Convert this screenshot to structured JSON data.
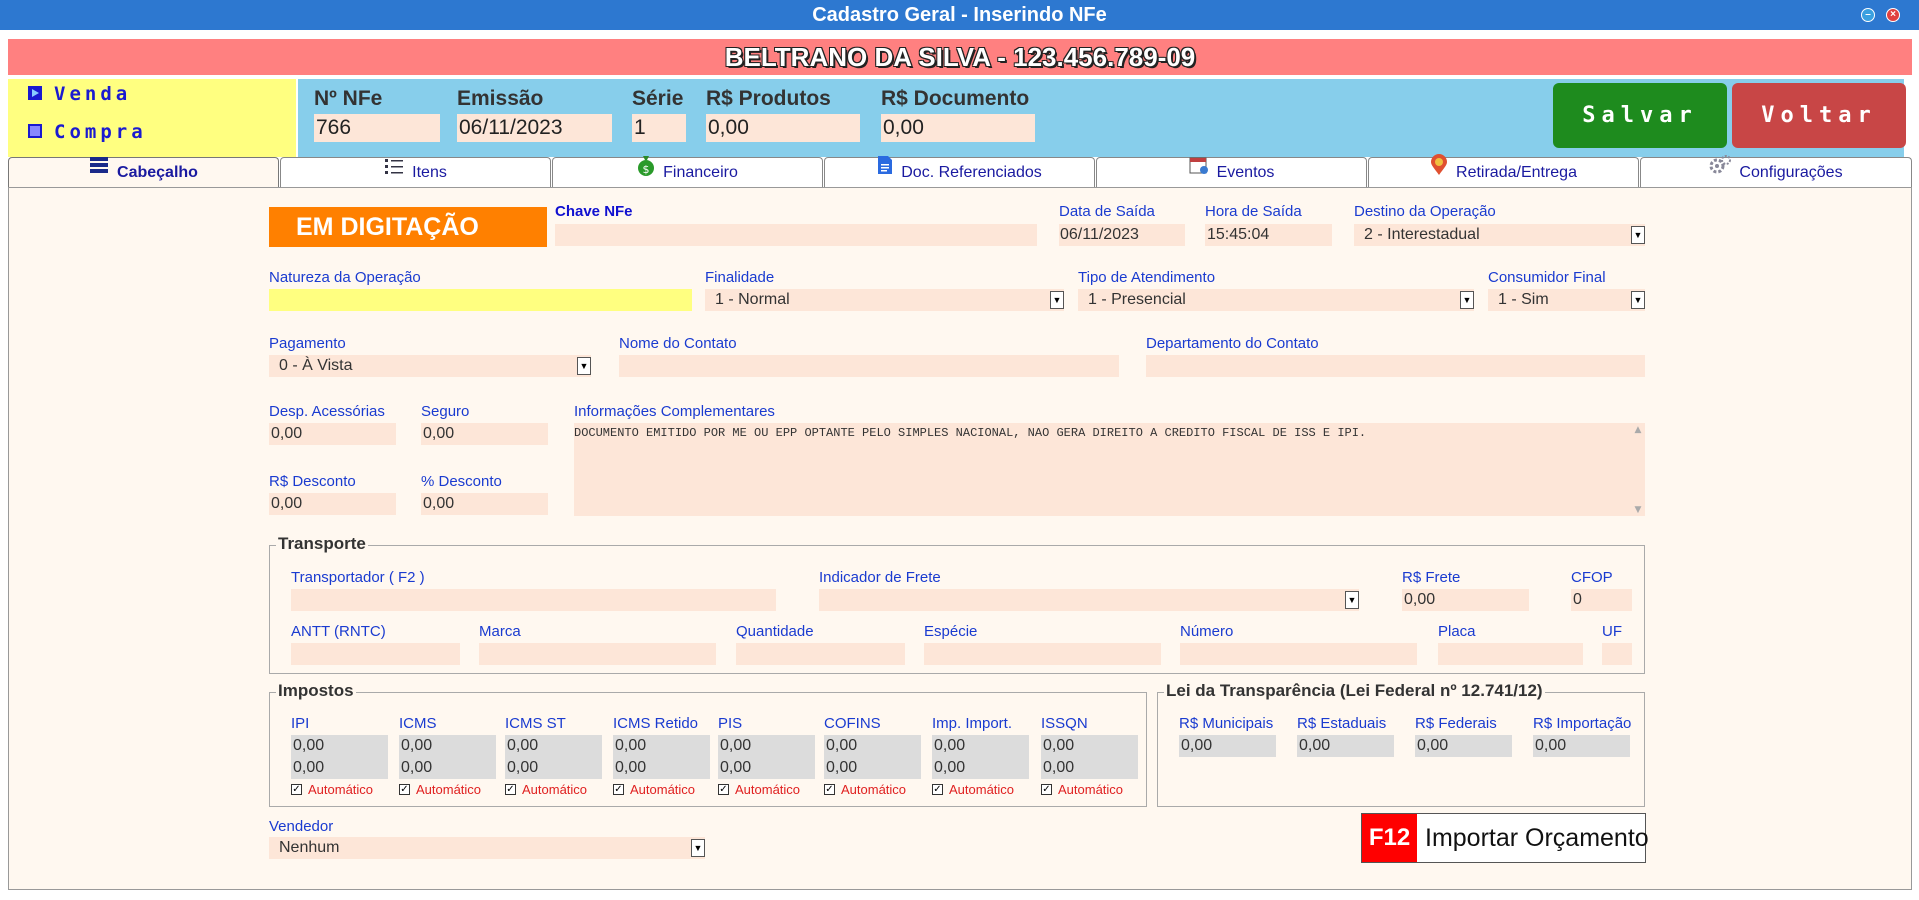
{
  "window": {
    "title": "Cadastro Geral - Inserindo NFe"
  },
  "customer": {
    "name": "BELTRANO DA SILVA - 123.456.789-09"
  },
  "type_options": {
    "venda": "Venda",
    "compra": "Compra"
  },
  "header": {
    "nfe_label": "Nº NFe",
    "nfe_value": "766",
    "emissao_label": "Emissão",
    "emissao_value": "06/11/2023",
    "serie_label": "Série",
    "serie_value": "1",
    "produtos_label": "R$ Produtos",
    "produtos_value": "0,00",
    "documento_label": "R$ Documento",
    "documento_value": "0,00"
  },
  "buttons": {
    "salvar": "Salvar",
    "voltar": "Voltar"
  },
  "tabs": [
    {
      "label": "Cabeçalho",
      "icon": "list-icon"
    },
    {
      "label": "Itens",
      "icon": "bullet-list-icon"
    },
    {
      "label": "Financeiro",
      "icon": "money-bag-icon"
    },
    {
      "label": "Doc. Referenciados",
      "icon": "document-icon"
    },
    {
      "label": "Eventos",
      "icon": "calendar-icon"
    },
    {
      "label": "Retirada/Entrega",
      "icon": "location-pin-icon"
    },
    {
      "label": "Configurações",
      "icon": "gears-icon"
    }
  ],
  "form": {
    "status": "EM DIGITAÇÃO",
    "chave_label": "Chave NFe",
    "chave_value": "",
    "data_saida_label": "Data de Saída",
    "data_saida_value": "06/11/2023",
    "hora_saida_label": "Hora de Saída",
    "hora_saida_value": "15:45:04",
    "destino_label": "Destino da Operação",
    "destino_value": "2 - Interestadual",
    "natureza_label": "Natureza da Operação",
    "natureza_value": "",
    "finalidade_label": "Finalidade",
    "finalidade_value": "1 - Normal",
    "atendimento_label": "Tipo de Atendimento",
    "atendimento_value": "1 - Presencial",
    "consumidor_label": "Consumidor Final",
    "consumidor_value": "1 - Sim",
    "pagamento_label": "Pagamento",
    "pagamento_value": "0 - À Vista",
    "contato_label": "Nome do Contato",
    "contato_value": "",
    "departamento_label": "Departamento do Contato",
    "departamento_value": "",
    "despesas_label": "Desp. Acessórias",
    "despesas_value": "0,00",
    "seguro_label": "Seguro",
    "seguro_value": "0,00",
    "info_label": "Informações Complementares",
    "info_value": "DOCUMENTO EMITIDO POR ME OU EPP OPTANTE PELO SIMPLES NACIONAL, NAO GERA DIREITO A CREDITO FISCAL DE ISS E IPI.",
    "desconto_label": "R$ Desconto",
    "desconto_value": "0,00",
    "pdesconto_label": "% Desconto",
    "pdesconto_value": "0,00"
  },
  "transporte": {
    "title": "Transporte",
    "transportador_label": "Transportador ( F2 )",
    "transportador_value": "",
    "frete_ind_label": "Indicador de Frete",
    "frete_ind_value": "",
    "frete_label": "R$ Frete",
    "frete_value": "0,00",
    "cfop_label": "CFOP",
    "cfop_value": "0",
    "antt_label": "ANTT (RNTC)",
    "antt_value": "",
    "marca_label": "Marca",
    "marca_value": "",
    "quantidade_label": "Quantidade",
    "quantidade_value": "",
    "especie_label": "Espécie",
    "especie_value": "",
    "numero_label": "Número",
    "numero_value": "",
    "placa_label": "Placa",
    "placa_value": "",
    "uf_label": "UF",
    "uf_value": ""
  },
  "impostos": {
    "title": "Impostos",
    "auto_label": "Automático",
    "items": [
      {
        "label": "IPI",
        "v1": "0,00",
        "v2": "0,00"
      },
      {
        "label": "ICMS",
        "v1": "0,00",
        "v2": "0,00"
      },
      {
        "label": "ICMS ST",
        "v1": "0,00",
        "v2": "0,00"
      },
      {
        "label": "ICMS Retido",
        "v1": "0,00",
        "v2": "0,00"
      },
      {
        "label": "PIS",
        "v1": "0,00",
        "v2": "0,00"
      },
      {
        "label": "COFINS",
        "v1": "0,00",
        "v2": "0,00"
      },
      {
        "label": "Imp. Import.",
        "v1": "0,00",
        "v2": "0,00"
      },
      {
        "label": "ISSQN",
        "v1": "0,00",
        "v2": "0,00"
      }
    ]
  },
  "transparencia": {
    "title": "Lei da Transparência (Lei Federal nº 12.741/12)",
    "items": [
      {
        "label": "R$ Municipais",
        "value": "0,00"
      },
      {
        "label": "R$ Estaduais",
        "value": "0,00"
      },
      {
        "label": "R$ Federais",
        "value": "0,00"
      },
      {
        "label": "R$ Importação",
        "value": "0,00"
      }
    ]
  },
  "vendedor": {
    "label": "Vendedor",
    "value": "Nenhum"
  },
  "importar": {
    "key": "F12",
    "label": "Importar Orçamento"
  },
  "colors": {
    "title_bar": "#2d78d0",
    "customer_bar": "#ff8080",
    "type_box": "#ffff80",
    "header_box": "#87ceeb",
    "salvar": "#1e8b1e",
    "voltar": "#c84646",
    "status": "#ff8000",
    "field": "#fde6d8",
    "f12": "#ff0000"
  }
}
